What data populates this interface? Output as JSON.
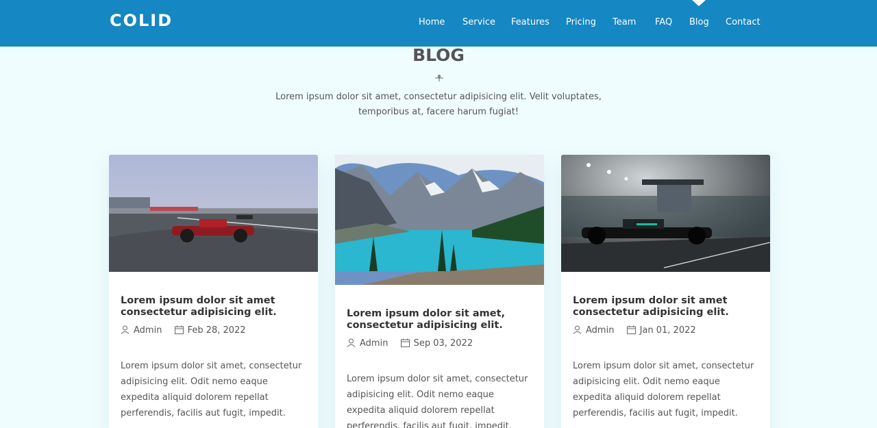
{
  "header": {
    "logo": "COLID",
    "nav": [
      "Home",
      "Service",
      "Features",
      "Pricing",
      "Team",
      "FAQ",
      "Blog",
      "Contact"
    ],
    "active": "Blog"
  },
  "section": {
    "title": "BLOG",
    "description": "Lorem ipsum dolor sit amet, consectetur adipisicing elit. Velit voluptates, temporibus at, facere harum fugiat!"
  },
  "posts": [
    {
      "image": "red-race-car-photo",
      "title": "Lorem ipsum dolor sit amet consectetur adipisicing elit.",
      "author": "Admin",
      "date": "Feb 28, 2022",
      "excerpt": "Lorem ipsum dolor sit amet, consectetur adipisicing elit. Odit nemo eaque expedita aliquid dolorem repellat perferendis, facilis aut fugit, impedit."
    },
    {
      "image": "mountain-lake-photo",
      "title": "Lorem ipsum dolor sit amet, consectetur adipisicing elit.",
      "author": "Admin",
      "date": "Sep 03, 2022",
      "excerpt": "Lorem ipsum dolor sit amet, consectetur adipisicing elit. Odit nemo eaque expedita aliquid dolorem repellat perferendis, facilis aut fugit, impedit."
    },
    {
      "image": "black-race-car-photo",
      "title": "Lorem ipsum dolor sit amet consectetur adipisicing elit.",
      "author": "Admin",
      "date": "Jan 01, 2022",
      "excerpt": "Lorem ipsum dolor sit amet, consectetur adipisicing elit. Odit nemo eaque expedita aliquid dolorem repellat perferendis, facilis aut fugit, impedit."
    }
  ],
  "colors": {
    "header": "#1587c2",
    "background": "#f0fdfe",
    "text": "#555555"
  }
}
